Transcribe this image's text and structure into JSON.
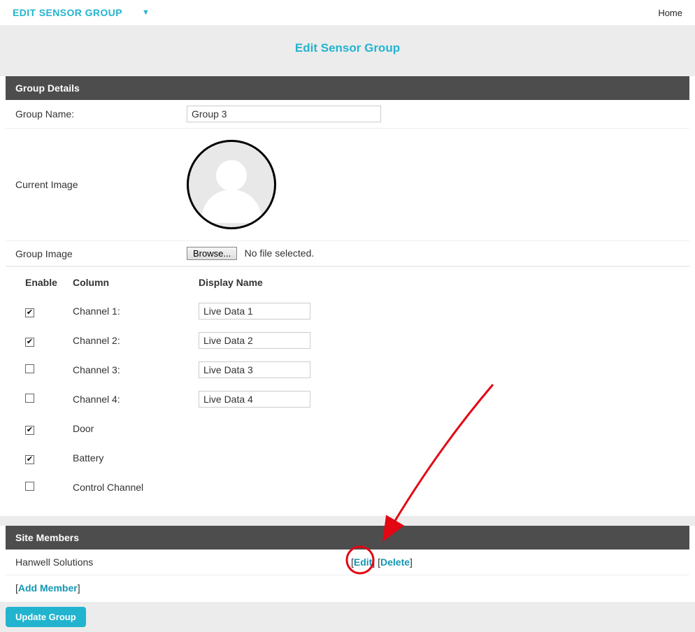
{
  "header": {
    "dropdown_label": "EDIT SENSOR GROUP",
    "home_label": "Home"
  },
  "page_title": "Edit Sensor Group",
  "group_details": {
    "section_title": "Group Details",
    "group_name_label": "Group Name:",
    "group_name_value": "Group 3",
    "current_image_label": "Current Image",
    "group_image_label": "Group Image",
    "browse_label": "Browse...",
    "no_file_text": "No file selected."
  },
  "channels": {
    "enable_header": "Enable",
    "column_header": "Column",
    "display_header": "Display Name",
    "rows": [
      {
        "enabled": true,
        "label": "Channel 1:",
        "value": "Live Data 1",
        "has_input": true
      },
      {
        "enabled": true,
        "label": "Channel 2:",
        "value": "Live Data 2",
        "has_input": true
      },
      {
        "enabled": false,
        "label": "Channel 3:",
        "value": "Live Data 3",
        "has_input": true
      },
      {
        "enabled": false,
        "label": "Channel 4:",
        "value": "Live Data 4",
        "has_input": true
      },
      {
        "enabled": true,
        "label": "Door",
        "value": "",
        "has_input": false
      },
      {
        "enabled": true,
        "label": "Battery",
        "value": "",
        "has_input": false
      },
      {
        "enabled": false,
        "label": "Control Channel",
        "value": "",
        "has_input": false
      }
    ]
  },
  "site_members": {
    "section_title": "Site Members",
    "members": [
      {
        "name": "Hanwell Solutions"
      }
    ],
    "edit_label": "Edit",
    "delete_label": "Delete",
    "add_member_label": "Add Member"
  },
  "footer": {
    "update_label": "Update Group"
  }
}
